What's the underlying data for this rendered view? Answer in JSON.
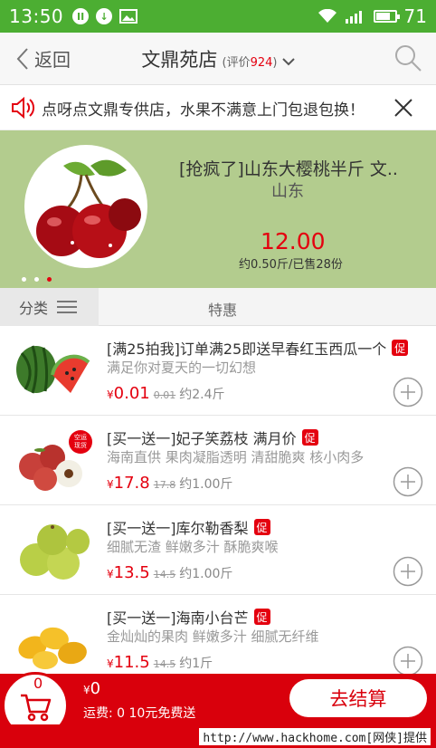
{
  "status_bar": {
    "time": "13:50",
    "battery": "71",
    "battery_level": 0.71
  },
  "header": {
    "back_label": "返回",
    "store_name": "文鼎苑店",
    "rating_prefix": "(评价",
    "rating_count": "924",
    "rating_suffix": ")"
  },
  "notice": {
    "text": "点呀点文鼎专供店，水果不满意上门包退包换！"
  },
  "banner": {
    "title": "[抢疯了]山东大樱桃半斤 文..",
    "subtitle": "山东",
    "price": "12.00",
    "meta": "约0.50斤/已售28份",
    "page_count": 3,
    "active_page": 3
  },
  "category_bar": {
    "left_label": "分类",
    "right_label": "特惠"
  },
  "products": [
    {
      "title": "[满25拍我]订单满25即送早春红玉西瓜一个",
      "badge": "促",
      "desc": "满足你对夏天的一切幻想",
      "yen": "¥",
      "price": "0.01",
      "orig": "0.01",
      "unit": "约2.4斤",
      "thumb": "watermelon"
    },
    {
      "title": "[买一送一]妃子笑荔枝 满月价",
      "badge": "促",
      "desc": "海南直供  果肉凝脂透明  清甜脆爽  核小肉多",
      "yen": "¥",
      "price": "17.8",
      "orig": "17.8",
      "unit": "约1.00斤",
      "thumb": "lychee",
      "thumb_tag": [
        "空运",
        "现货"
      ]
    },
    {
      "title": "[买一送一]库尔勒香梨",
      "badge": "促",
      "desc": "细腻无渣  鲜嫩多汁  酥脆爽喉",
      "yen": "¥",
      "price": "13.5",
      "orig": "14.5",
      "unit": "约1.00斤",
      "thumb": "pear"
    },
    {
      "title": "[买一送一]海南小台芒",
      "badge": "促",
      "desc": "金灿灿的果肉  鲜嫩多汁  细腻无纤维",
      "yen": "¥",
      "price": "11.5",
      "orig": "14.5",
      "unit": "约1斤",
      "thumb": "mango"
    }
  ],
  "cart": {
    "count": "0",
    "yen": "¥",
    "total": "0",
    "shipping": "运费: 0  10元免费送",
    "checkout_label": "去结算"
  },
  "watermark": {
    "text": "http://www.hackhome.com[网侠]提供"
  },
  "colors": {
    "accent": "#d9000c",
    "price": "#e4000f",
    "status_bar": "#4cae32",
    "banner_bg": "#b3cc8e"
  }
}
